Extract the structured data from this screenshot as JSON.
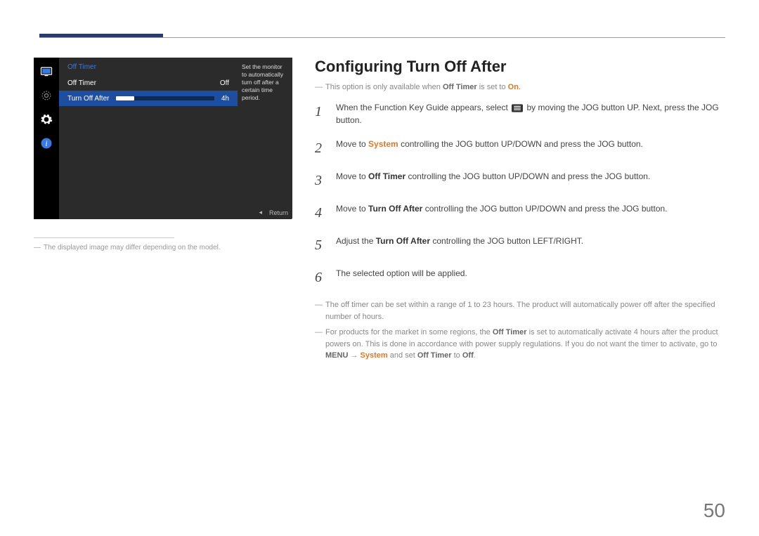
{
  "header": {},
  "osd": {
    "title": "Off Timer",
    "rows": [
      {
        "label": "Off Timer",
        "value": "Off"
      },
      {
        "label": "Turn Off After",
        "value": "4h"
      }
    ],
    "desc": "Set the monitor to automatically turn off after a certain time period.",
    "return_label": "Return"
  },
  "caption": "The displayed image may differ depending on the model.",
  "title": "Configuring Turn Off After",
  "avail_note": {
    "pre": "This option is only available when ",
    "bold": "Off Timer",
    "mid": " is set to ",
    "on": "On",
    "post": "."
  },
  "steps": [
    {
      "pre": "When the Function Key Guide appears, select ",
      "post": " by moving the JOG button UP. Next, press the JOG button."
    },
    {
      "pre": "Move to ",
      "hl": "System",
      "post": " controlling the JOG button UP/DOWN and press the JOG button."
    },
    {
      "pre": "Move to ",
      "hl": "Off Timer",
      "post": " controlling the JOG button UP/DOWN and press the JOG button."
    },
    {
      "pre": "Move to ",
      "hl": "Turn Off After",
      "post": " controlling the JOG button UP/DOWN and press the JOG button."
    },
    {
      "pre": "Adjust the ",
      "hl": "Turn Off After",
      "post": " controlling the JOG button LEFT/RIGHT."
    },
    {
      "text": "The selected option will be applied."
    }
  ],
  "footnotes": [
    "The off timer can be set within a range of 1 to 23 hours. The product will automatically power off after the specified number of hours."
  ],
  "footnote2": {
    "p1": "For products for the market in some regions, the ",
    "b1": "Off Timer",
    "p2": " is set to automatically activate 4 hours after the product powers on. This is done in accordance with power supply regulations. If you do not want the timer to activate, go to ",
    "b2": "MENU",
    "arrow": " → ",
    "hl": "System",
    "p3": " and set ",
    "b3": "Off Timer",
    "p4": " to ",
    "b4": "Off",
    "p5": "."
  },
  "page_number": "50"
}
